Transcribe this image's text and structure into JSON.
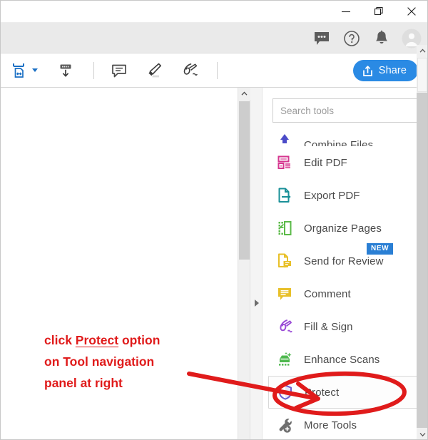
{
  "window": {
    "controls": [
      {
        "name": "minimize",
        "glyph": "minimize-icon"
      },
      {
        "name": "restore",
        "glyph": "restore-icon"
      },
      {
        "name": "close",
        "glyph": "close-icon"
      }
    ]
  },
  "graybar": {
    "icons": [
      {
        "name": "chat-icon",
        "title": "Chat"
      },
      {
        "name": "help-icon",
        "title": "Help"
      },
      {
        "name": "bell-icon",
        "title": "Notifications"
      },
      {
        "name": "avatar-icon",
        "title": "Account"
      }
    ]
  },
  "toolbar": {
    "items": [
      {
        "name": "fit-page-icon",
        "title": "Fit page",
        "color": "#1a6fc4",
        "has_caret": true
      },
      {
        "name": "download-icon",
        "title": "Download",
        "color": "#3c3c3c"
      },
      {
        "name": "comment-icon",
        "title": "Add comment",
        "color": "#4a4a4a"
      },
      {
        "name": "highlight-icon",
        "title": "Highlight text",
        "color": "#3c3c3c"
      },
      {
        "name": "sign-icon",
        "title": "Fill and sign",
        "color": "#3c3c3c"
      }
    ],
    "share_label": "Share",
    "share_color": "#2a8ae4"
  },
  "search": {
    "placeholder": "Search tools",
    "value": ""
  },
  "tools": {
    "items": [
      {
        "label": "Combine Files",
        "icon": "combine-files-icon",
        "color": "#4b4bc8",
        "clipped": true,
        "badge": "",
        "hovered": false
      },
      {
        "label": "Edit PDF",
        "icon": "edit-pdf-icon",
        "color": "#d6368f",
        "clipped": false,
        "badge": "",
        "hovered": false
      },
      {
        "label": "Export PDF",
        "icon": "export-pdf-icon",
        "color": "#1a9098",
        "clipped": false,
        "badge": "",
        "hovered": false
      },
      {
        "label": "Organize Pages",
        "icon": "organize-pages-icon",
        "color": "#5aba47",
        "clipped": false,
        "badge": "",
        "hovered": false
      },
      {
        "label": "Send for Review",
        "icon": "send-for-review-icon",
        "color": "#e8c029",
        "clipped": false,
        "badge": "NEW",
        "hovered": false
      },
      {
        "label": "Comment",
        "icon": "comment-tool-icon",
        "color": "#e8c029",
        "clipped": false,
        "badge": "",
        "hovered": false
      },
      {
        "label": "Fill & Sign",
        "icon": "fill-sign-icon",
        "color": "#9a4bd6",
        "clipped": false,
        "badge": "",
        "hovered": false
      },
      {
        "label": "Enhance Scans",
        "icon": "enhance-scans-icon",
        "color": "#4eb84e",
        "clipped": false,
        "badge": "",
        "hovered": false
      },
      {
        "label": "Protect",
        "icon": "protect-icon",
        "color": "#6a5bd0",
        "clipped": false,
        "badge": "",
        "hovered": true
      },
      {
        "label": "More Tools",
        "icon": "more-tools-icon",
        "color": "#6e6e6e",
        "clipped": false,
        "badge": "",
        "hovered": false
      }
    ],
    "badge_color": "#2a7fd4"
  },
  "annotation": {
    "line1_a": "click ",
    "line1_b": "Protect",
    "line1_c": " option",
    "line2": "on Tool navigation",
    "line3": "panel at right",
    "color": "#e01b1b"
  }
}
